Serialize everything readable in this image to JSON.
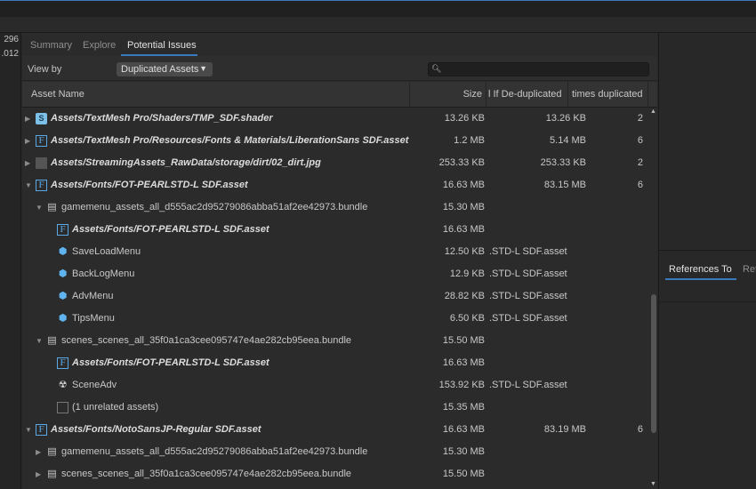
{
  "left_strip": {
    "values": [
      "296",
      ".012"
    ]
  },
  "tabs": [
    {
      "label": "Summary",
      "active": false
    },
    {
      "label": "Explore",
      "active": false
    },
    {
      "label": "Potential Issues",
      "active": true
    }
  ],
  "viewby": {
    "label": "View by",
    "selected": "Duplicated Assets",
    "search_placeholder": ""
  },
  "columns": {
    "name": "Asset Name",
    "size": "Size",
    "dedup": "l If De-duplicated",
    "times": "times duplicated"
  },
  "rows": [
    {
      "name": "Assets/TextMesh Pro/Shaders/TMP_SDF.shader",
      "icon": "shader-icon",
      "bold": true,
      "indent": 0,
      "arrow": "right",
      "size": "13.26 KB",
      "dedup": "13.26 KB",
      "times": "2"
    },
    {
      "name": "Assets/TextMesh Pro/Resources/Fonts & Materials/LiberationSans SDF.asset",
      "icon": "font-asset-icon",
      "bold": true,
      "indent": 0,
      "arrow": "right",
      "size": "1.2 MB",
      "dedup": "5.14 MB",
      "times": "6"
    },
    {
      "name": "Assets/StreamingAssets_RawData/storage/dirt/02_dirt.jpg",
      "icon": "image-icon",
      "bold": true,
      "indent": 0,
      "arrow": "right",
      "size": "253.33 KB",
      "dedup": "253.33 KB",
      "times": "2"
    },
    {
      "name": "Assets/Fonts/FOT-PEARLSTD-L SDF.asset",
      "icon": "font-asset-icon",
      "bold": true,
      "indent": 0,
      "arrow": "down",
      "size": "16.63 MB",
      "dedup": "83.15 MB",
      "times": "6"
    },
    {
      "name": "gamemenu_assets_all_d555ac2d95279086abba51af2ee42973.bundle",
      "icon": "bundle-icon",
      "bold": false,
      "indent": 1,
      "arrow": "down",
      "size": "15.30 MB",
      "dedup": "",
      "times": ""
    },
    {
      "name": "Assets/Fonts/FOT-PEARLSTD-L SDF.asset",
      "icon": "font-asset-icon",
      "bold": true,
      "indent": 2,
      "arrow": "",
      "size": "16.63 MB",
      "dedup": "",
      "times": ""
    },
    {
      "name": "SaveLoadMenu",
      "icon": "prefab-icon",
      "bold": false,
      "indent": 2,
      "arrow": "",
      "size": "12.50 KB",
      "dedup": ".STD-L SDF.asset",
      "times": ""
    },
    {
      "name": "BackLogMenu",
      "icon": "prefab-icon",
      "bold": false,
      "indent": 2,
      "arrow": "",
      "size": "12.9 KB",
      "dedup": ".STD-L SDF.asset",
      "times": ""
    },
    {
      "name": "AdvMenu",
      "icon": "prefab-icon",
      "bold": false,
      "indent": 2,
      "arrow": "",
      "size": "28.82 KB",
      "dedup": ".STD-L SDF.asset",
      "times": ""
    },
    {
      "name": "TipsMenu",
      "icon": "prefab-icon",
      "bold": false,
      "indent": 2,
      "arrow": "",
      "size": "6.50 KB",
      "dedup": ".STD-L SDF.asset",
      "times": ""
    },
    {
      "name": "scenes_scenes_all_35f0a1ca3cee095747e4ae282cb95eea.bundle",
      "icon": "bundle-icon",
      "bold": false,
      "indent": 1,
      "arrow": "down",
      "size": "15.50 MB",
      "dedup": "",
      "times": ""
    },
    {
      "name": "Assets/Fonts/FOT-PEARLSTD-L SDF.asset",
      "icon": "font-asset-icon",
      "bold": true,
      "indent": 2,
      "arrow": "",
      "size": "16.63 MB",
      "dedup": "",
      "times": ""
    },
    {
      "name": "SceneAdv",
      "icon": "scene-icon",
      "bold": false,
      "indent": 2,
      "arrow": "",
      "size": "153.92 KB",
      "dedup": ".STD-L SDF.asset",
      "times": ""
    },
    {
      "name": "(1 unrelated assets)",
      "icon": "unrelated-icon",
      "bold": false,
      "indent": 2,
      "arrow": "",
      "size": "15.35 MB",
      "dedup": "",
      "times": ""
    },
    {
      "name": "Assets/Fonts/NotoSansJP-Regular SDF.asset",
      "icon": "font-asset-icon",
      "bold": true,
      "indent": 0,
      "arrow": "down",
      "size": "16.63 MB",
      "dedup": "83.19 MB",
      "times": "6"
    },
    {
      "name": "gamemenu_assets_all_d555ac2d95279086abba51af2ee42973.bundle",
      "icon": "bundle-icon",
      "bold": false,
      "indent": 1,
      "arrow": "right",
      "size": "15.30 MB",
      "dedup": "",
      "times": ""
    },
    {
      "name": "scenes_scenes_all_35f0a1ca3cee095747e4ae282cb95eea.bundle",
      "icon": "bundle-icon",
      "bold": false,
      "indent": 1,
      "arrow": "right",
      "size": "15.50 MB",
      "dedup": "",
      "times": ""
    }
  ],
  "right_panel": {
    "tab_active": "References To",
    "tab_inactive": "Ref"
  },
  "colors": {
    "accent": "#3a79bb",
    "background": "#282828",
    "header": "#333333"
  }
}
